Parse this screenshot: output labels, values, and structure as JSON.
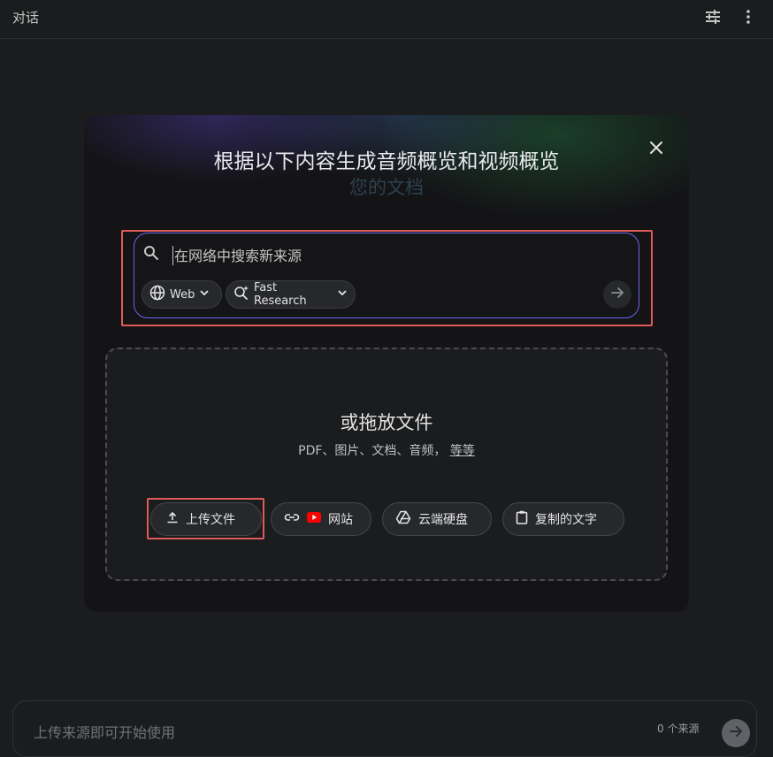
{
  "header": {
    "title": "对话",
    "settings_icon": "tune-icon",
    "more_icon": "more-vert-icon"
  },
  "modal": {
    "heading": "根据以下内容生成音频概览和视频概览",
    "subheading": "您的文档",
    "close_icon": "close-icon"
  },
  "search": {
    "placeholder": "在网络中搜索新来源",
    "source_chip": "Web",
    "mode_chip": "Fast Research",
    "accent_color": "#6b63f2"
  },
  "dropzone": {
    "title": "或拖放文件",
    "formats": "PDF、图片、文档、音频，",
    "more_link": "等等",
    "buttons": {
      "upload": "上传文件",
      "website": "网站",
      "drive": "云端硬盘",
      "paste": "复制的文字"
    }
  },
  "chat": {
    "placeholder": "上传来源即可开始使用",
    "source_count": "0 个来源"
  },
  "highlight_color": "#e05a5a"
}
